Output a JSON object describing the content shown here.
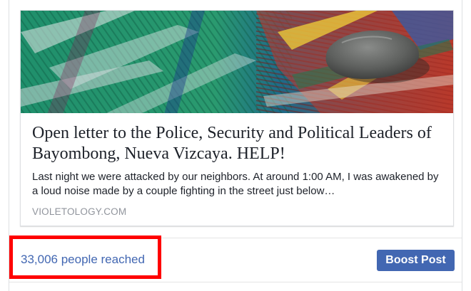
{
  "link_preview": {
    "image_subject": "Stone on woven plaid fabric",
    "title": "Open letter to the Police, Security and Political Leaders of Bayombong, Nueva Vizcaya. HELP!",
    "description": "Last night we were attacked by our neighbors. At around 1:00 AM, I was awakened by a loud noise made by a couple fighting in the street just below…",
    "domain": "VIOLETOLOGY.COM"
  },
  "footer": {
    "reach_text": "33,006 people reached",
    "boost_label": "Boost Post"
  },
  "colors": {
    "link_blue": "#4267b2",
    "highlight_red": "#ff0000",
    "title_text": "#1d2129",
    "domain_gray": "#90949c"
  }
}
